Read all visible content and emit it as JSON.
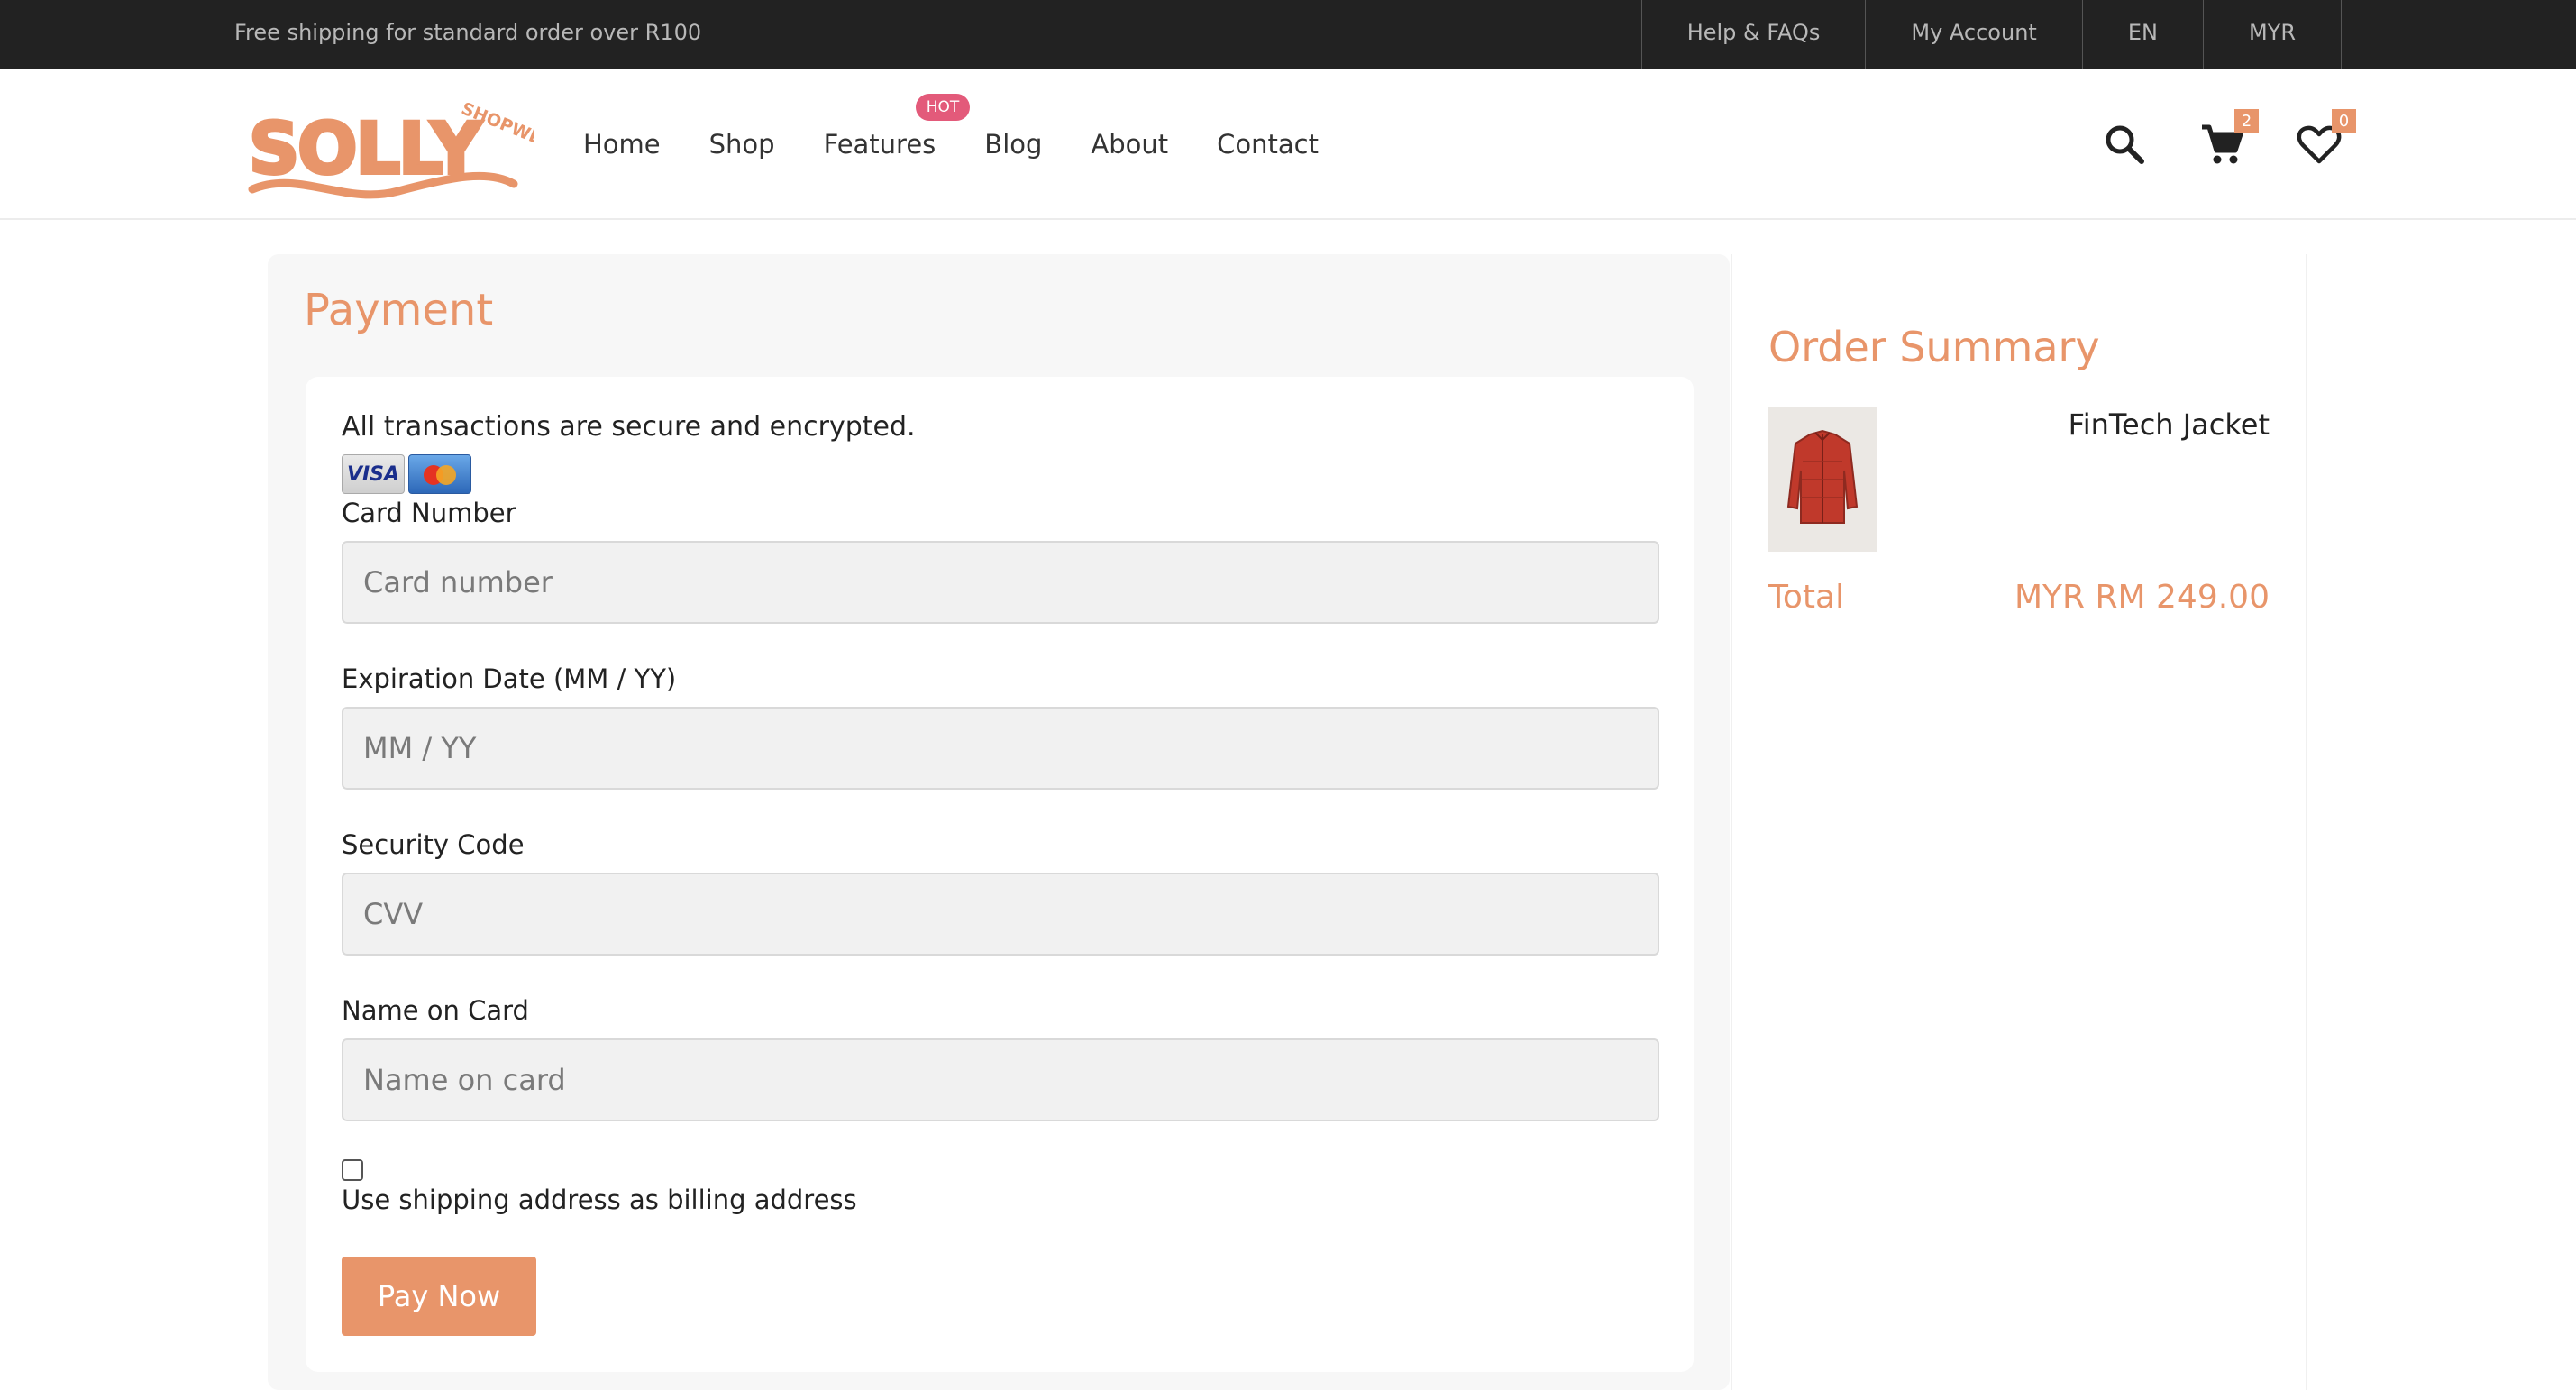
{
  "topbar": {
    "promo": "Free shipping for standard order over R100",
    "links": [
      "Help & FAQs",
      "My Account",
      "EN",
      "MYR"
    ]
  },
  "header": {
    "logo_text": "SOLLY",
    "logo_sub": "SHOPWE",
    "nav": [
      "Home",
      "Shop",
      "Features",
      "Blog",
      "About",
      "Contact"
    ],
    "hot_badge": "HOT",
    "cart_count": "2",
    "wishlist_count": "0",
    "icons": [
      "search-icon",
      "cart-icon",
      "heart-icon"
    ]
  },
  "payment": {
    "title": "Payment",
    "secure_text": "All transactions are secure and encrypted.",
    "card_brands": [
      "VISA",
      "MasterCard"
    ],
    "fields": {
      "card_number": {
        "label": "Card Number",
        "placeholder": "Card number"
      },
      "expiration": {
        "label": "Expiration Date (MM / YY)",
        "placeholder": "MM / YY"
      },
      "security": {
        "label": "Security Code",
        "placeholder": "CVV"
      },
      "name": {
        "label": "Name on Card",
        "placeholder": "Name on card"
      }
    },
    "billing_checkbox_label": "Use shipping address as billing address",
    "billing_checked": false,
    "pay_button": "Pay Now"
  },
  "summary": {
    "title": "Order Summary",
    "product_name": "FinTech Jacket",
    "total_label": "Total",
    "total_value": "MYR RM 249.00"
  },
  "colors": {
    "accent": "#e8956a",
    "topbar_bg": "#222222",
    "hot_badge": "#e35a7a"
  }
}
